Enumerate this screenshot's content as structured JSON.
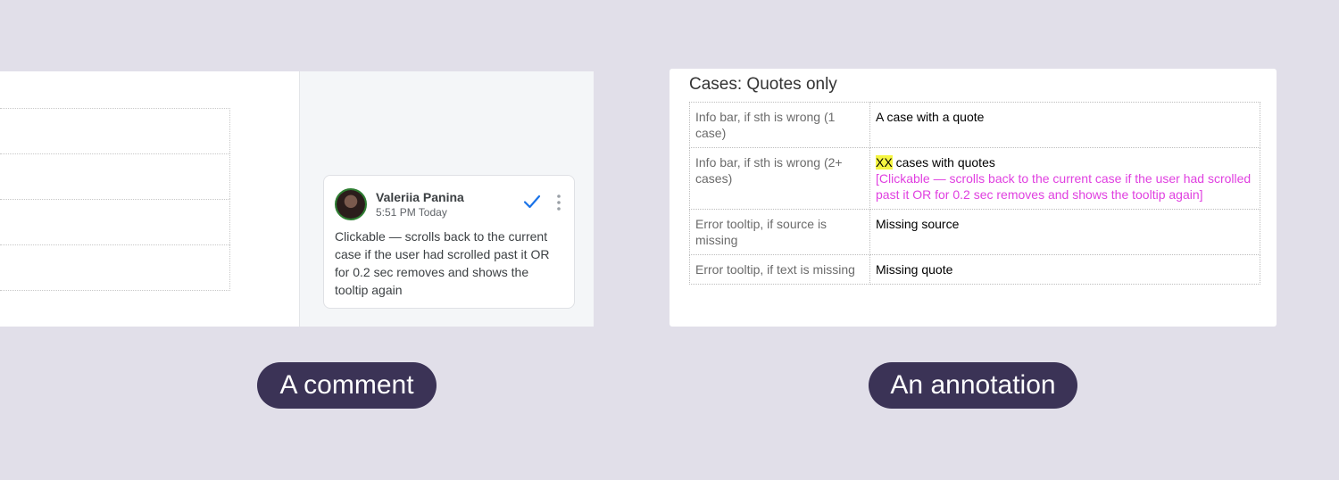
{
  "comment_example": {
    "author": "Valeriia Panina",
    "timestamp": "5:51 PM Today",
    "text": "Clickable — scrolls back to the current case if the user had scrolled past it OR for 0.2 sec removes and shows the tooltip again",
    "label": "A comment",
    "icons": [
      "avatar",
      "checkmark-icon",
      "more-vertical-icon"
    ]
  },
  "annotation_example": {
    "title": "Cases: Quotes only",
    "rows": [
      {
        "case": "Info bar, if sth is wrong (1 case)",
        "text": "A case with a quote",
        "highlight": "",
        "note": ""
      },
      {
        "case": "Info bar, if sth is wrong (2+ cases)",
        "highlight": "XX",
        "text": " cases with quotes",
        "note": "[Clickable — scrolls back to the current case if the user had scrolled past it OR for 0.2 sec removes and shows the tooltip again]"
      },
      {
        "case": "Error tooltip, if source is missing",
        "text": "Missing source",
        "highlight": "",
        "note": ""
      },
      {
        "case": "Error tooltip, if text is missing",
        "text": "Missing quote",
        "highlight": "",
        "note": ""
      }
    ],
    "label": "An annotation",
    "colors": {
      "highlight": "#f5f542",
      "note": "#e040e0"
    }
  },
  "colors": {
    "background": "#e1dfe9",
    "pill": "#3b3356",
    "check": "#1a73e8"
  }
}
